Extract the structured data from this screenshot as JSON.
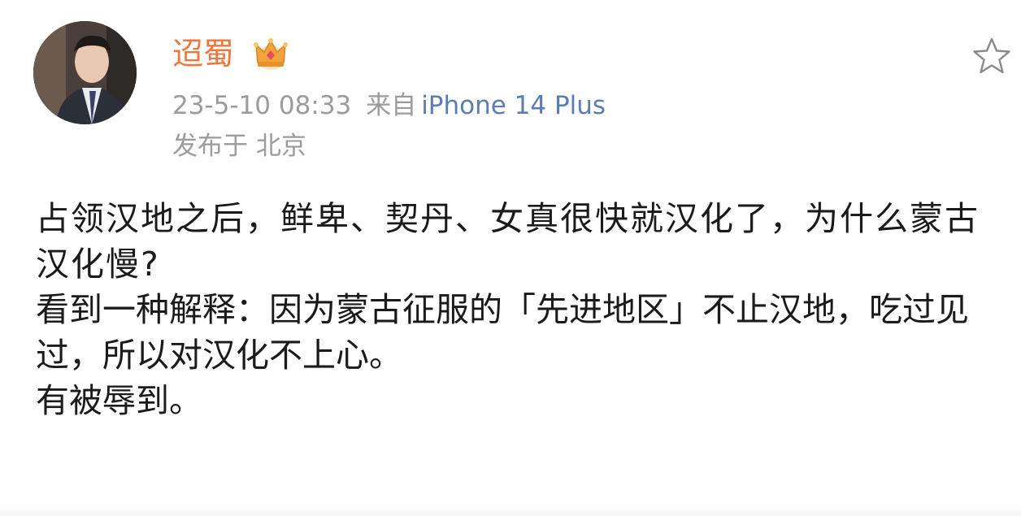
{
  "post": {
    "author": {
      "name": "迢蜀",
      "avatar_icon": "user-avatar",
      "badge_icon": "crown-icon"
    },
    "meta": {
      "time": "23-5-10 08:33",
      "source_prefix": "来自",
      "source": "iPhone 14 Plus",
      "location": "发布于 北京"
    },
    "actions": {
      "favorite_icon": "star-icon"
    },
    "content": {
      "paragraphs": [
        "占领汉地之后，鲜卑、契丹、女真很快就汉化了，为什么蒙古汉化慢?",
        "看到一种解释：因为蒙古征服的「先进地区」不止汉地，吃过见过，所以对汉化不上心。",
        "有被辱到。"
      ]
    }
  },
  "colors": {
    "username": "#f0763c",
    "meta": "#9b9b9b",
    "source_link": "#5b7cb4",
    "body_text": "#1a1a1a",
    "crown": "#f2a23a"
  }
}
